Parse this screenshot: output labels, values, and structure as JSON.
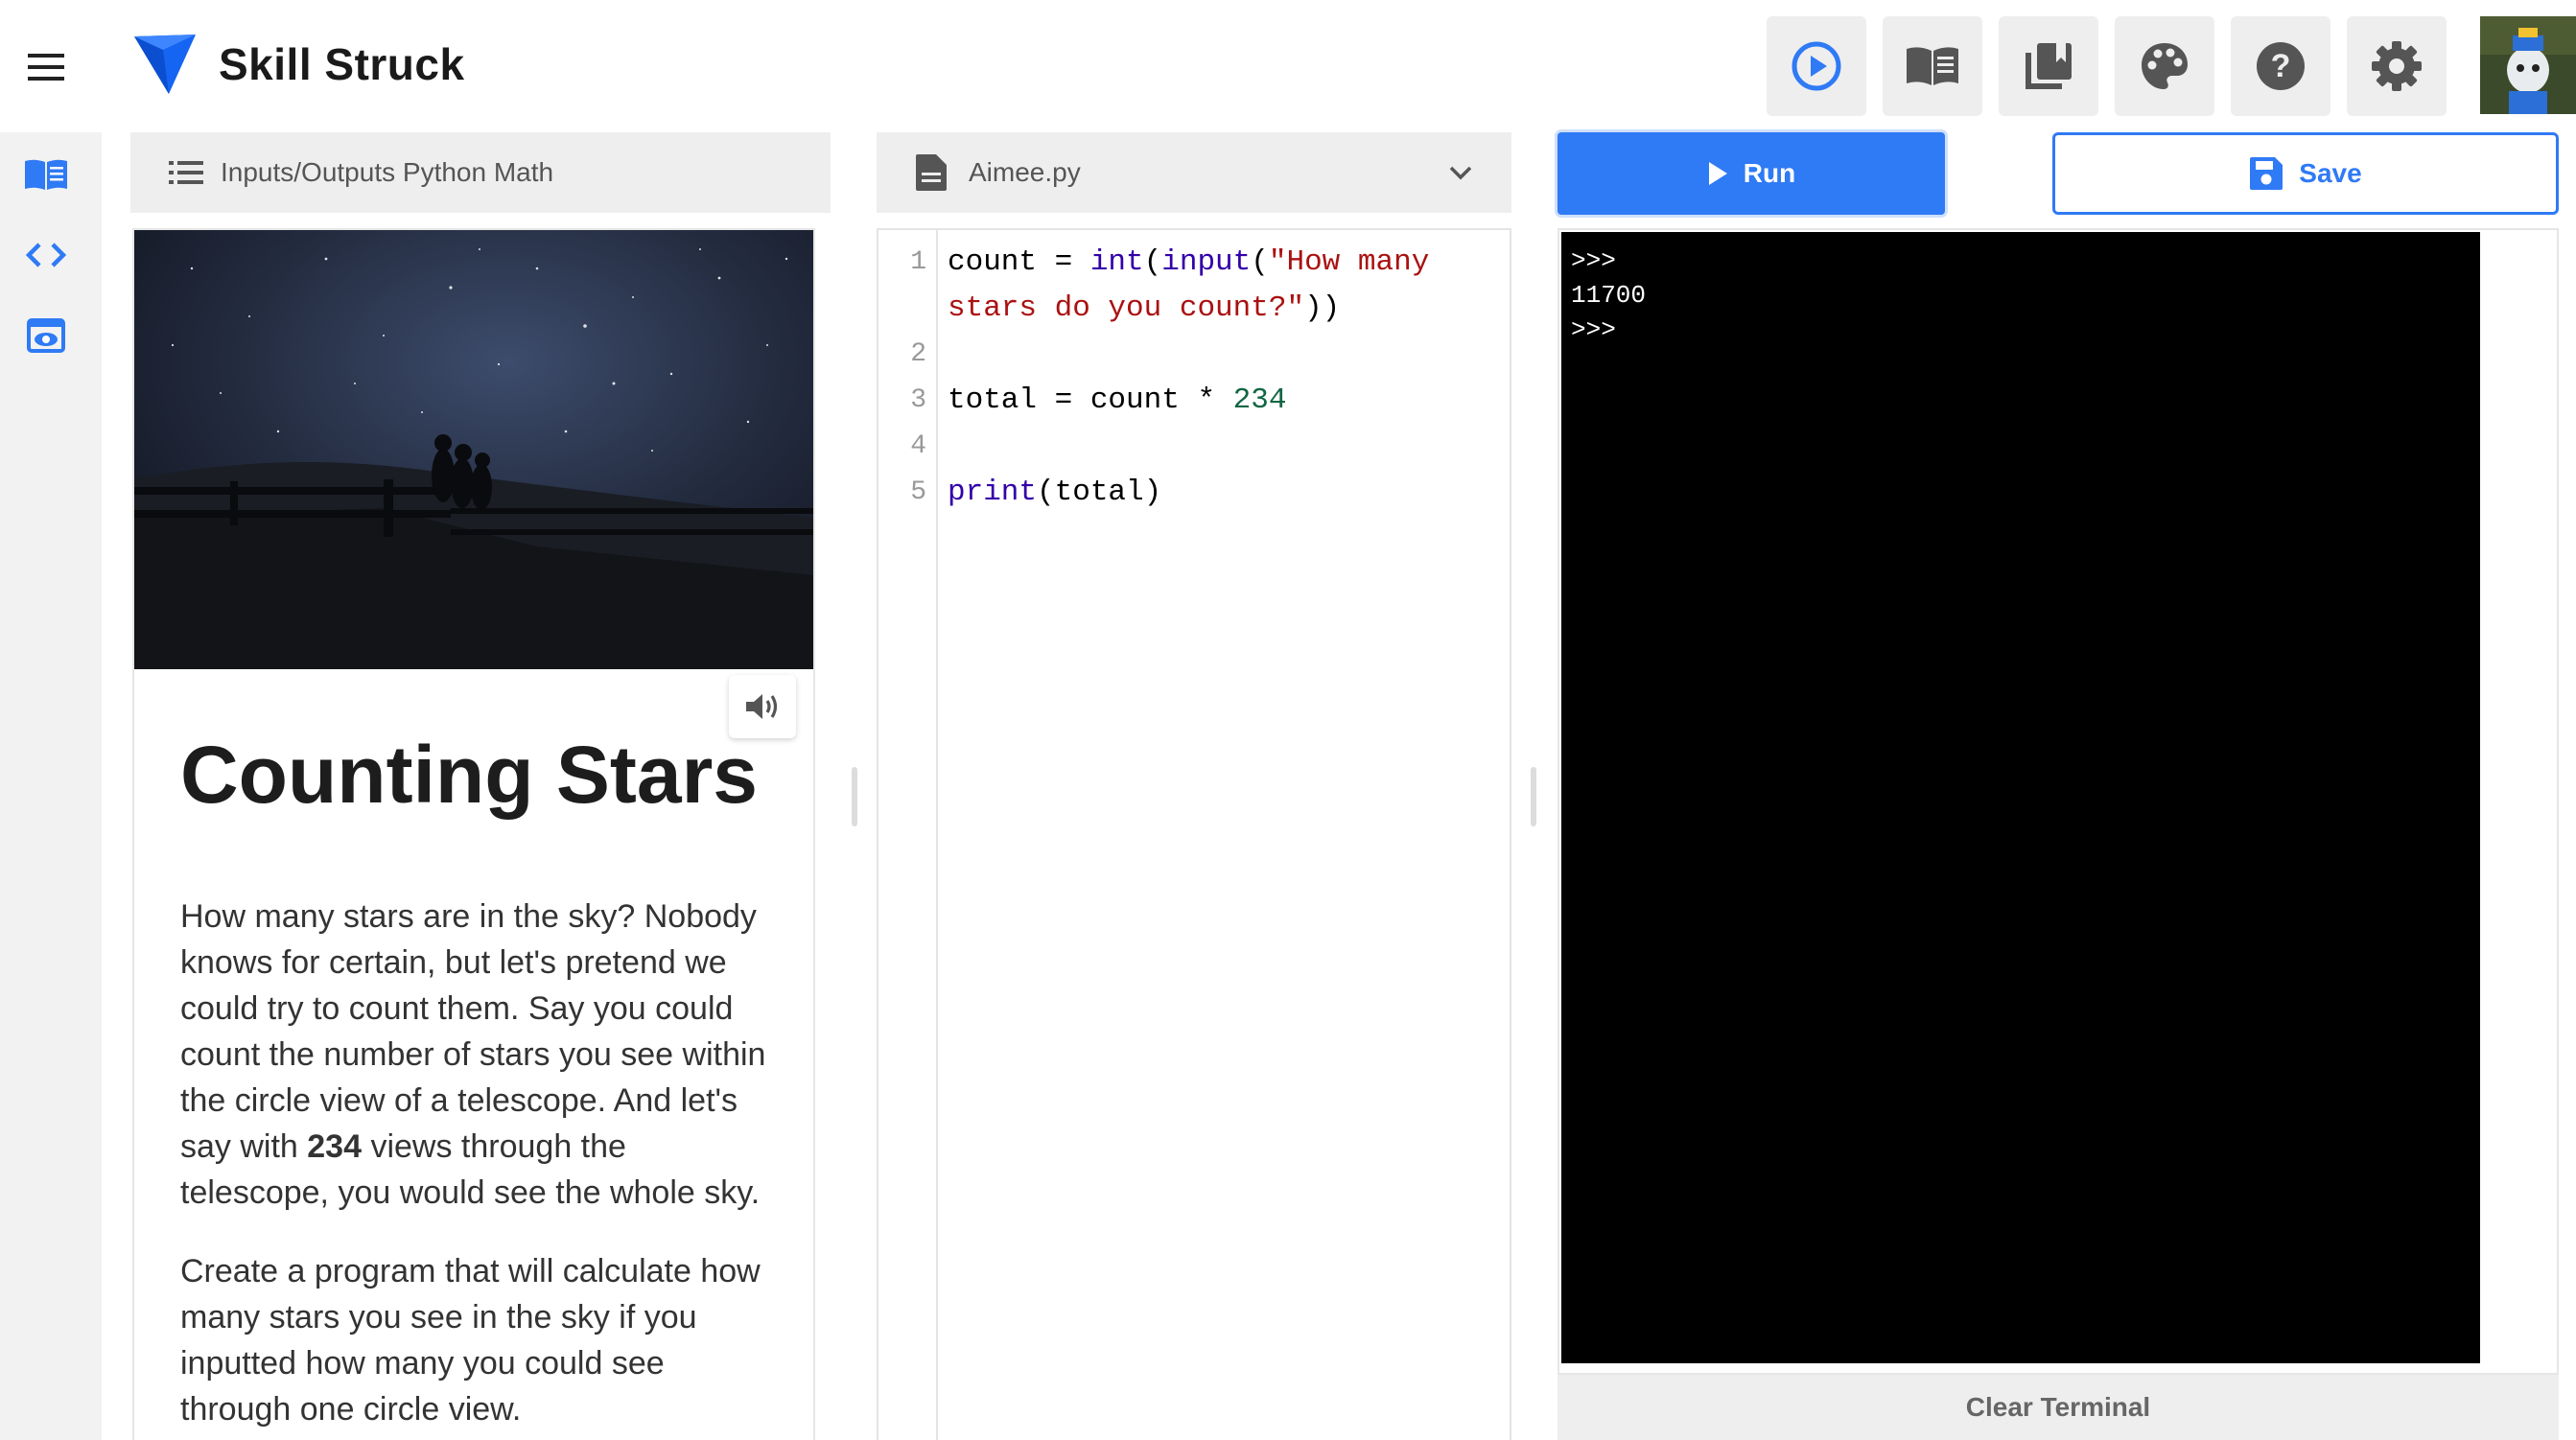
{
  "brand": {
    "name": "Skill Struck",
    "accent": "#2f7af5",
    "logo_color": "#1565f2"
  },
  "header": {
    "tools": [
      {
        "icon": "play-circle-icon"
      },
      {
        "icon": "book-open-icon"
      },
      {
        "icon": "library-icon"
      },
      {
        "icon": "palette-icon"
      },
      {
        "icon": "help-icon"
      },
      {
        "icon": "gear-icon"
      }
    ],
    "avatar": "avatar"
  },
  "rail": {
    "items": [
      "lesson-book-icon",
      "code-icon",
      "preview-eye-icon"
    ]
  },
  "lesson": {
    "breadcrumb": "Inputs/Outputs Python Math",
    "title": "Counting Stars",
    "para1_a": "How many stars are in the sky? Nobody knows for certain, but let's pretend we could try to count them. Say you could count the number of stars you see within the circle view of a telescope. And let's say with ",
    "para1_bold": "234",
    "para1_b": " views through the telescope, you would see the whole sky.",
    "para2": "Create a program that will calculate how many stars you see in the sky if you inputted how many you could see through one circle view."
  },
  "editor": {
    "filename": "Aimee.py",
    "line_numbers": [
      "1",
      "2",
      "3",
      "4",
      "5"
    ],
    "code": {
      "l1_var": "count = ",
      "l1_int": "int",
      "l1_p1": "(",
      "l1_input": "input",
      "l1_p2": "(",
      "l1_str_a": "\"How many",
      "l1_str_b": "stars do you count?\"",
      "l1_close": "))",
      "l3_text": "total = count * ",
      "l3_num": "234",
      "l5_print": "print",
      "l5_args": "(total)"
    }
  },
  "actions": {
    "run": "Run",
    "save": "Save",
    "clear": "Clear Terminal"
  },
  "terminal": {
    "output": ">>>\n11700\n>>>"
  }
}
